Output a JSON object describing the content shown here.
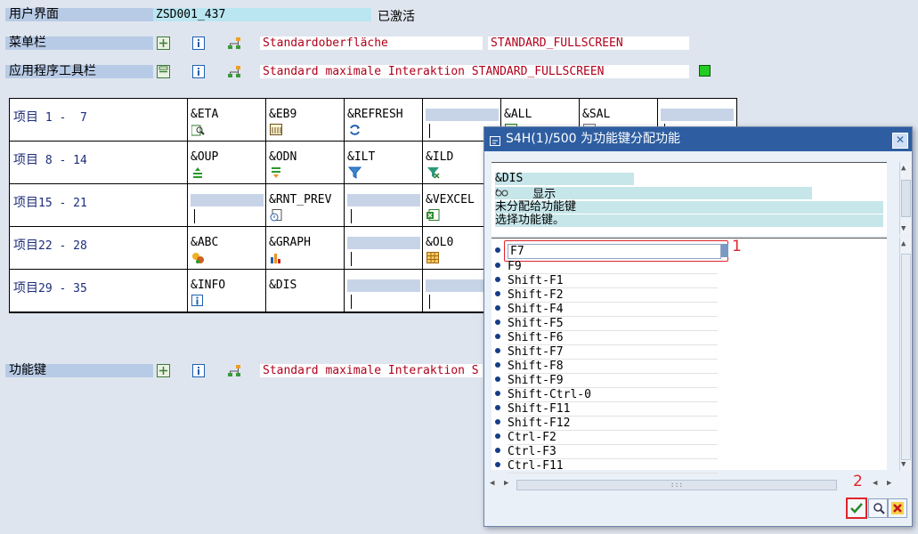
{
  "rows": {
    "ui": {
      "label": "用户界面",
      "value": "ZSD001_437",
      "status": "已激活"
    },
    "menu": {
      "label": "菜单栏",
      "name1": "Standardoberfläche",
      "name2": "STANDARD_FULLSCREEN"
    },
    "toolbar": {
      "label": "应用程序工具栏",
      "text": "Standard maximale Interaktion STANDARD_FULLSCREEN"
    },
    "fkeys": {
      "label": "功能键",
      "text": "Standard maximale Interaktion S"
    }
  },
  "grid": {
    "row_labels": [
      {
        "word": "项目",
        "range": " 1 -  7"
      },
      {
        "word": "项目",
        "range": " 8 - 14"
      },
      {
        "word": "项目",
        "range": "15 - 21"
      },
      {
        "word": "项目",
        "range": "22 - 28"
      },
      {
        "word": "项目",
        "range": "29 - 35"
      }
    ],
    "cells": [
      [
        "&ETA",
        "&EB9",
        "&REFRESH",
        "",
        "&ALL",
        "&SAL",
        ""
      ],
      [
        "&OUP",
        "&ODN",
        "&ILT",
        "&ILD",
        "",
        "",
        ""
      ],
      [
        "",
        "&RNT_PREV",
        "",
        "&VEXCEL",
        "",
        "",
        ""
      ],
      [
        "&ABC",
        "&GRAPH",
        "",
        "&OL0",
        "",
        "",
        ""
      ],
      [
        "&INFO",
        "&DIS",
        "",
        "",
        "",
        "",
        ""
      ]
    ]
  },
  "dialog": {
    "title": "S4H(1)/500 为功能键分配功能",
    "close": "✕",
    "code": "&DIS",
    "display_text": "显示",
    "info1": "未分配给功能键",
    "info2": "选择功能键。",
    "selected_key": "F7",
    "keys": [
      "F9",
      "Shift-F1",
      "Shift-F2",
      "Shift-F4",
      "Shift-F5",
      "Shift-F6",
      "Shift-F7",
      "Shift-F8",
      "Shift-F9",
      "Shift-Ctrl-0",
      "Shift-F11",
      "Shift-F12",
      "Ctrl-F2",
      "Ctrl-F3",
      "Ctrl-F11"
    ],
    "marker1": "1",
    "marker2": "2",
    "hscroll_grip": ":::"
  },
  "colors": {
    "title_bar": "#2e5ea1",
    "label_bg": "#b8cbe6",
    "value_red": "#b0001c",
    "active_green": "#22cc22",
    "highlight": "#c6e6ea",
    "annotation_red": "#e0242c"
  }
}
